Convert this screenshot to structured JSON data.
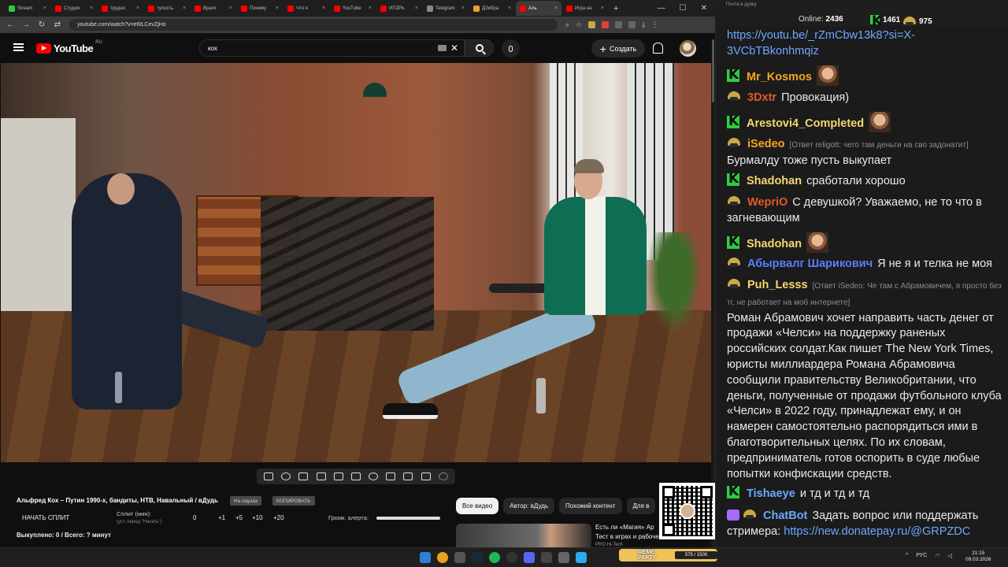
{
  "browser": {
    "tabs": [
      {
        "label": "Stream",
        "color": "#2ecc40"
      },
      {
        "label": "Студия",
        "color": "#ff0000"
      },
      {
        "label": "трудно",
        "color": "#ff0000"
      },
      {
        "label": "тупость",
        "color": "#ff0000"
      },
      {
        "label": "Враги",
        "color": "#ff0000"
      },
      {
        "label": "Почему",
        "color": "#ff0000"
      },
      {
        "label": "Что я",
        "color": "#ff0000"
      },
      {
        "label": "YouTube",
        "color": "#ff0000"
      },
      {
        "label": "ИГОРЬ",
        "color": "#ff0000"
      },
      {
        "label": "Telegram",
        "color": "#888888"
      },
      {
        "label": "ДЗибра",
        "color": "#f0a030"
      },
      {
        "label": "Аль",
        "color": "#ff0000",
        "active": true
      },
      {
        "label": "Игра на",
        "color": "#ff0000"
      }
    ],
    "url": "youtube.com/watch?v=e6tLCevZjHo",
    "new_tab": "+",
    "win_min": "—",
    "win_max": "☐",
    "win_close": "✕"
  },
  "youtube": {
    "logo_text": "YouTube",
    "logo_region": "RU",
    "search_value": "кох",
    "create_label": "Создать",
    "video_title": "Альфред Кох – Путин 1990-х, бандиты, НТВ, Навальный / вДудь",
    "pill_pause": "На паузах",
    "pill_copy": "КОПИРОВАТЬ",
    "split_button": "НАЧАТЬ СПЛИТ",
    "split_label": "Сплит (мин):",
    "split_sub": "(уст. перед \"Начать\")",
    "split_values": [
      "0",
      "+1",
      "+5",
      "+10",
      "+20"
    ],
    "volume_label": "Громк. алерта:",
    "volume_level": 1.0,
    "bought": "Выкуплено: 0 / Всего: ? минут",
    "chips": [
      "Все видео",
      "Автор: вДудь",
      "Похожий контент",
      "Для в"
    ],
    "rec_title": "Есть ли «Магия» Ар",
    "rec_subtitle": "Тест в играх и рабочем ПО",
    "rec_channel": "PRO Hi-Tech"
  },
  "chat_header": {
    "hint": "Почта в дурку",
    "online_label": "Online:",
    "online_count": "2436",
    "k_count": "1461",
    "coin_count": "975"
  },
  "chat": [
    {
      "type": "link",
      "text": "https://youtu.be/_rZmCbw13k8?si=X-3VCbTBkonhmqiz"
    },
    {
      "badge": "k",
      "nick": "Mr_Kosmos",
      "color": "#f5a623",
      "text": "",
      "emote": true
    },
    {
      "badge": "b",
      "nick": "3Dxtr",
      "color": "#e05a2a",
      "text": "Провокация)"
    },
    {
      "badge": "k",
      "nick": "Arestovi4_Completed",
      "color": "#f5d76e",
      "text": "",
      "emote": true
    },
    {
      "badge": "b",
      "nick": "iSedeo",
      "color": "#f5a623",
      "reply": "[Ответ religott: чего там деньги на сво задонатит]",
      "text": "Бурмалду тоже пусть выкупает"
    },
    {
      "badge": "k",
      "nick": "Shadohan",
      "color": "#f5d76e",
      "text": "сработали хорошо"
    },
    {
      "badge": "b",
      "nick": "WepriO",
      "color": "#e05a2a",
      "text": "С девушкой? Уважаемо, не то что в загневающим"
    },
    {
      "badge": "k",
      "nick": "Shadohan",
      "color": "#f5d76e",
      "text": "",
      "emote": true
    },
    {
      "badge": "b",
      "nick": "Абырвалг Шарикович",
      "color": "#5b7dff",
      "text": "Я не я и телка не моя"
    },
    {
      "badge": "b",
      "nick": "Puh_Lesss",
      "color": "#f5d76e",
      "reply": "[Ответ iSedeo: Че там с Абрамовичем, я просто без тг, не работает на моб интернете]",
      "text": "Роман Абрамович хочет направить часть денег от продажи «Челси» на поддержку раненых российских солдат.Как пишет The New York Times, юристы миллиардера Романа Абрамовича сообщили правительству Великобритании, что деньги, полученные от продажи футбольного клуба «Челси» в 2022 году, принадлежат ему, и он намерен самостоятельно распорядиться ими в благотворительных целях. По их словам, предприниматель готов оспорить в суде любые попытки конфискации средств."
    },
    {
      "badge": "k",
      "nick": "Tishaeye",
      "color": "#6ea8ff",
      "text": "и тд и тд и тд"
    },
    {
      "badge": "bot",
      "nick": "ChatBot",
      "color": "#6ea8ff",
      "text": "Задать вопрос или поддержать стримера:",
      "link": "https://new.donatepay.ru/@GRPZDC"
    }
  ],
  "taskbar": {
    "meme_label": "MEME PARTY",
    "meme_progress": "575 / 1500",
    "lang": "РУС",
    "time": "21:15",
    "date": "09.03.2026"
  }
}
